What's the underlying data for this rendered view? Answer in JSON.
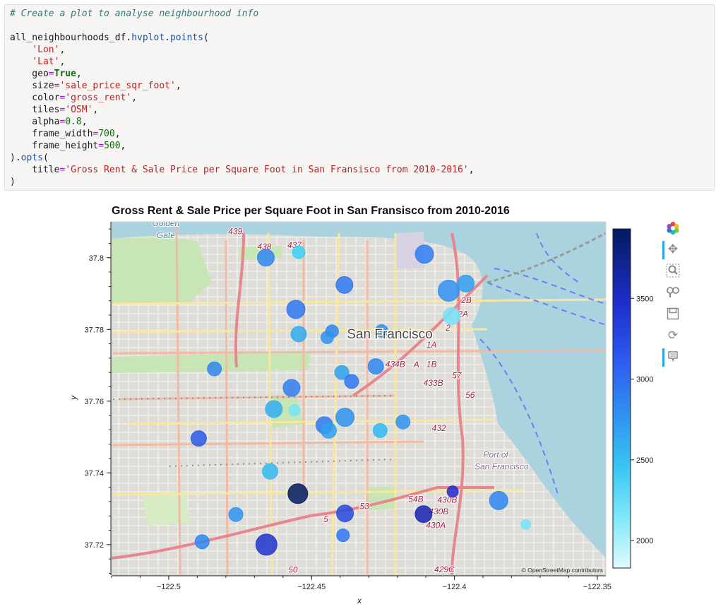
{
  "code_cell": {
    "lines": [
      [
        [
          "tk-comment",
          "# Create a plot to analyse neighbourhood info"
        ]
      ],
      [],
      [
        [
          "tk-plain",
          "all_neighbourhoods_df."
        ],
        [
          "tk-fn",
          "hvplot"
        ],
        [
          "tk-plain",
          "."
        ],
        [
          "tk-fn",
          "points"
        ],
        [
          "tk-plain",
          "("
        ]
      ],
      [
        [
          "tk-plain",
          "    "
        ],
        [
          "tk-str",
          "'Lon'"
        ],
        [
          "tk-plain",
          ","
        ]
      ],
      [
        [
          "tk-plain",
          "    "
        ],
        [
          "tk-str",
          "'Lat'"
        ],
        [
          "tk-plain",
          ","
        ]
      ],
      [
        [
          "tk-plain",
          "    geo"
        ],
        [
          "tk-op",
          "="
        ],
        [
          "tk-kw",
          "True"
        ],
        [
          "tk-plain",
          ","
        ]
      ],
      [
        [
          "tk-plain",
          "    size"
        ],
        [
          "tk-op",
          "="
        ],
        [
          "tk-str",
          "'sale_price_sqr_foot'"
        ],
        [
          "tk-plain",
          ","
        ]
      ],
      [
        [
          "tk-plain",
          "    color"
        ],
        [
          "tk-op",
          "="
        ],
        [
          "tk-str",
          "'gross_rent'"
        ],
        [
          "tk-plain",
          ","
        ]
      ],
      [
        [
          "tk-plain",
          "    tiles"
        ],
        [
          "tk-op",
          "="
        ],
        [
          "tk-str",
          "'OSM'"
        ],
        [
          "tk-plain",
          ","
        ]
      ],
      [
        [
          "tk-plain",
          "    alpha"
        ],
        [
          "tk-op",
          "="
        ],
        [
          "tk-num",
          "0.8"
        ],
        [
          "tk-plain",
          ","
        ]
      ],
      [
        [
          "tk-plain",
          "    frame_width"
        ],
        [
          "tk-op",
          "="
        ],
        [
          "tk-num",
          "700"
        ],
        [
          "tk-plain",
          ","
        ]
      ],
      [
        [
          "tk-plain",
          "    frame_height"
        ],
        [
          "tk-op",
          "="
        ],
        [
          "tk-num",
          "500"
        ],
        [
          "tk-plain",
          ","
        ]
      ],
      [
        [
          "tk-plain",
          ")."
        ],
        [
          "tk-fn",
          "opts"
        ],
        [
          "tk-plain",
          "("
        ]
      ],
      [
        [
          "tk-plain",
          "    title"
        ],
        [
          "tk-op",
          "="
        ],
        [
          "tk-str",
          "'Gross Rent & Sale Price per Square Foot in San Fransisco from 2010-2016'"
        ],
        [
          "tk-plain",
          ","
        ]
      ],
      [
        [
          "tk-plain",
          ")"
        ]
      ]
    ]
  },
  "chart_data": {
    "type": "scatter",
    "title": "Gross Rent & Sale Price per Square Foot in San Fransisco from 2010-2016",
    "xlabel": "x",
    "ylabel": "y",
    "xlim": [
      -122.52,
      -122.347
    ],
    "ylim": [
      37.7115,
      37.81
    ],
    "x_ticks": [
      -122.5,
      -122.45,
      -122.4,
      -122.35
    ],
    "x_tick_labels": [
      "−122.5",
      "−122.45",
      "−122.4",
      "−122.35"
    ],
    "y_ticks": [
      37.72,
      37.74,
      37.76,
      37.78,
      37.8
    ],
    "y_tick_labels": [
      "37.72",
      "37.74",
      "37.76",
      "37.78",
      "37.8"
    ],
    "size_field": "sale_price_sqr_foot",
    "color_field": "gross_rent",
    "colorbar": {
      "ticks": [
        2000,
        2500,
        3000,
        3500
      ],
      "tick_labels": [
        "2000",
        "2500",
        "3000",
        "3500"
      ],
      "range": [
        1830,
        3930
      ],
      "colors": [
        "#e0fbfc",
        "#38d6f5",
        "#2fa4ef",
        "#2f6bf2",
        "#1e28c8",
        "#041a5e"
      ]
    },
    "points": [
      {
        "lon": -122.466,
        "lat": 37.8,
        "gross_rent": 2900,
        "size": 12
      },
      {
        "lon": -122.4545,
        "lat": 37.8015,
        "gross_rent": 2300,
        "size": 9
      },
      {
        "lon": -122.4105,
        "lat": 37.801,
        "gross_rent": 2950,
        "size": 13
      },
      {
        "lon": -122.4385,
        "lat": 37.7924,
        "gross_rent": 3000,
        "size": 12
      },
      {
        "lon": -122.402,
        "lat": 37.7908,
        "gross_rent": 2800,
        "size": 15
      },
      {
        "lon": -122.396,
        "lat": 37.7928,
        "gross_rent": 2700,
        "size": 12
      },
      {
        "lon": -122.4555,
        "lat": 37.7856,
        "gross_rent": 3000,
        "size": 13
      },
      {
        "lon": -122.401,
        "lat": 37.7837,
        "gross_rent": 2100,
        "size": 12
      },
      {
        "lon": -122.4545,
        "lat": 37.7787,
        "gross_rent": 2600,
        "size": 11
      },
      {
        "lon": -122.4428,
        "lat": 37.7795,
        "gross_rent": 2900,
        "size": 9
      },
      {
        "lon": -122.4445,
        "lat": 37.7778,
        "gross_rent": 2800,
        "size": 9
      },
      {
        "lon": -122.4255,
        "lat": 37.7796,
        "gross_rent": 2800,
        "size": 9
      },
      {
        "lon": -122.484,
        "lat": 37.769,
        "gross_rent": 2900,
        "size": 10
      },
      {
        "lon": -122.4394,
        "lat": 37.768,
        "gross_rent": 2700,
        "size": 10
      },
      {
        "lon": -122.4275,
        "lat": 37.7697,
        "gross_rent": 2900,
        "size": 11
      },
      {
        "lon": -122.436,
        "lat": 37.7655,
        "gross_rent": 3000,
        "size": 10
      },
      {
        "lon": -122.457,
        "lat": 37.7637,
        "gross_rent": 2950,
        "size": 12
      },
      {
        "lon": -122.4632,
        "lat": 37.7578,
        "gross_rent": 2600,
        "size": 12
      },
      {
        "lon": -122.456,
        "lat": 37.7575,
        "gross_rent": 2100,
        "size": 8
      },
      {
        "lon": -122.4383,
        "lat": 37.7555,
        "gross_rent": 2800,
        "size": 13
      },
      {
        "lon": -122.4455,
        "lat": 37.7533,
        "gross_rent": 3000,
        "size": 12
      },
      {
        "lon": -122.444,
        "lat": 37.7518,
        "gross_rent": 2700,
        "size": 11
      },
      {
        "lon": -122.426,
        "lat": 37.7518,
        "gross_rent": 2500,
        "size": 10
      },
      {
        "lon": -122.418,
        "lat": 37.7542,
        "gross_rent": 2800,
        "size": 10
      },
      {
        "lon": -122.4895,
        "lat": 37.7496,
        "gross_rent": 3200,
        "size": 11
      },
      {
        "lon": -122.4645,
        "lat": 37.7404,
        "gross_rent": 2500,
        "size": 11
      },
      {
        "lon": -122.4548,
        "lat": 37.7342,
        "gross_rent": 3930,
        "size": 14
      },
      {
        "lon": -122.4006,
        "lat": 37.7348,
        "gross_rent": 3500,
        "size": 8
      },
      {
        "lon": -122.4108,
        "lat": 37.7285,
        "gross_rent": 3600,
        "size": 12
      },
      {
        "lon": -122.3845,
        "lat": 37.7323,
        "gross_rent": 2900,
        "size": 13
      },
      {
        "lon": -122.4383,
        "lat": 37.7287,
        "gross_rent": 3300,
        "size": 12
      },
      {
        "lon": -122.4765,
        "lat": 37.7284,
        "gross_rent": 2800,
        "size": 10
      },
      {
        "lon": -122.439,
        "lat": 37.7226,
        "gross_rent": 3000,
        "size": 9
      },
      {
        "lon": -122.4883,
        "lat": 37.7208,
        "gross_rent": 2900,
        "size": 10
      },
      {
        "lon": -122.4658,
        "lat": 37.72,
        "gross_rent": 3450,
        "size": 15
      },
      {
        "lon": -122.375,
        "lat": 37.7256,
        "gross_rent": 2100,
        "size": 7
      }
    ]
  },
  "map": {
    "attribution": "© OpenStreetMap contributors",
    "city_label": "San Francisco",
    "labels": [
      {
        "text": "Golden",
        "style": "water",
        "lon": -122.501,
        "lat": 37.8088
      },
      {
        "text": "Gate",
        "style": "water",
        "lon": -122.501,
        "lat": 37.8055
      },
      {
        "text": "Port of",
        "style": "place",
        "lon": -122.3855,
        "lat": 37.7443
      },
      {
        "text": "San Francisco",
        "style": "place",
        "lon": -122.3835,
        "lat": 37.741
      },
      {
        "text": "439",
        "style": "route",
        "lon": -122.4767,
        "lat": 37.8066
      },
      {
        "text": "438",
        "style": "route",
        "lon": -122.4665,
        "lat": 37.8023
      },
      {
        "text": "437",
        "style": "route",
        "lon": -122.456,
        "lat": 37.8027
      },
      {
        "text": "2B",
        "style": "route",
        "lon": -122.3958,
        "lat": 37.7873
      },
      {
        "text": "2A",
        "style": "route",
        "lon": -122.397,
        "lat": 37.7835
      },
      {
        "text": "2",
        "style": "route",
        "lon": -122.4022,
        "lat": 37.7797
      },
      {
        "text": "1A",
        "style": "route",
        "lon": -122.408,
        "lat": 37.7749
      },
      {
        "text": "434B",
        "style": "route",
        "lon": -122.4207,
        "lat": 37.7695
      },
      {
        "text": "A",
        "style": "route",
        "lon": -122.4133,
        "lat": 37.7694
      },
      {
        "text": "1B",
        "style": "route",
        "lon": -122.408,
        "lat": 37.7695
      },
      {
        "text": "57",
        "style": "route",
        "lon": -122.3992,
        "lat": 37.7664
      },
      {
        "text": "433B",
        "style": "route",
        "lon": -122.4074,
        "lat": 37.7643
      },
      {
        "text": "56",
        "style": "route",
        "lon": -122.3945,
        "lat": 37.7609
      },
      {
        "text": "432",
        "style": "route",
        "lon": -122.4054,
        "lat": 37.7517
      },
      {
        "text": "54B",
        "style": "route",
        "lon": -122.4135,
        "lat": 37.7319
      },
      {
        "text": "430B",
        "style": "route",
        "lon": -122.4025,
        "lat": 37.7317
      },
      {
        "text": "53",
        "style": "route",
        "lon": -122.4315,
        "lat": 37.7299
      },
      {
        "text": "430B",
        "style": "route",
        "lon": -122.4055,
        "lat": 37.7284
      },
      {
        "text": "430A",
        "style": "route",
        "lon": -122.4065,
        "lat": 37.7246
      },
      {
        "text": "429C",
        "style": "route",
        "lon": -122.4035,
        "lat": 37.7123
      },
      {
        "text": "50",
        "style": "route",
        "lon": -122.4565,
        "lat": 37.7122
      },
      {
        "text": "5",
        "style": "route",
        "lon": -122.445,
        "lat": 37.7263
      }
    ]
  },
  "toolbar": {
    "icons": [
      "bokeh-logo-icon",
      "pan-icon",
      "box-zoom-icon",
      "wheel-zoom-icon",
      "save-icon",
      "reset-icon",
      "hover-icon"
    ]
  }
}
